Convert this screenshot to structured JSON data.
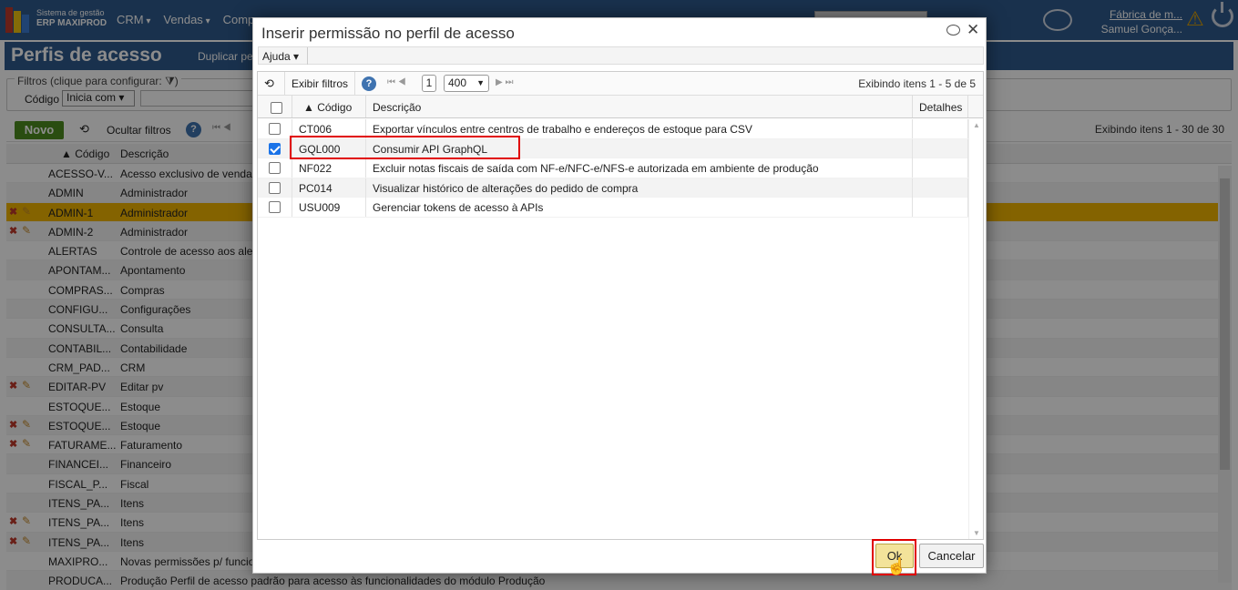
{
  "app": {
    "brand_line1": "Sistema de gestão",
    "brand_line2": "ERP MAXIPROD",
    "menu": [
      "CRM",
      "Vendas",
      "Compras"
    ],
    "user_company": "Fábrica de m...",
    "user_name": "Samuel Gonça..."
  },
  "page": {
    "title": "Perfis de acesso",
    "duplicate_label": "Duplicar pe",
    "filters_legend": "Filtros (clique para configurar: ⧩)",
    "filter_field_label": "Código",
    "filter_operator": "Inicia com",
    "new_button": "Novo",
    "hide_filters": "Ocultar filtros",
    "showing": "Exibindo itens 1 - 30 de 30",
    "col_code": "▲ Código",
    "col_desc": "Descrição",
    "rows": [
      {
        "code": "ACESSO-V...",
        "desc": "Acesso exclusivo de vendas",
        "edit": false,
        "selected": false
      },
      {
        "code": "ADMIN",
        "desc": "Administrador",
        "edit": false,
        "selected": false
      },
      {
        "code": "ADMIN-1",
        "desc": "Administrador",
        "edit": true,
        "selected": true
      },
      {
        "code": "ADMIN-2",
        "desc": "Administrador",
        "edit": true,
        "selected": false
      },
      {
        "code": "ALERTAS",
        "desc": "Controle de acesso aos ale",
        "edit": false,
        "selected": false
      },
      {
        "code": "APONTAM...",
        "desc": "Apontamento",
        "edit": false,
        "selected": false
      },
      {
        "code": "COMPRAS...",
        "desc": "Compras",
        "edit": false,
        "selected": false
      },
      {
        "code": "CONFIGU...",
        "desc": "Configurações",
        "edit": false,
        "selected": false
      },
      {
        "code": "CONSULTA...",
        "desc": "Consulta",
        "edit": false,
        "selected": false
      },
      {
        "code": "CONTABIL...",
        "desc": "Contabilidade",
        "edit": false,
        "selected": false
      },
      {
        "code": "CRM_PAD...",
        "desc": "CRM",
        "edit": false,
        "selected": false
      },
      {
        "code": "EDITAR-PV",
        "desc": "Editar pv",
        "edit": true,
        "selected": false
      },
      {
        "code": "ESTOQUE...",
        "desc": "Estoque",
        "edit": false,
        "selected": false
      },
      {
        "code": "ESTOQUE...",
        "desc": "Estoque",
        "edit": true,
        "selected": false
      },
      {
        "code": "FATURAME...",
        "desc": "Faturamento",
        "edit": true,
        "selected": false
      },
      {
        "code": "FINANCEI...",
        "desc": "Financeiro",
        "edit": false,
        "selected": false
      },
      {
        "code": "FISCAL_P...",
        "desc": "Fiscal",
        "edit": false,
        "selected": false
      },
      {
        "code": "ITENS_PA...",
        "desc": "Itens",
        "edit": false,
        "selected": false
      },
      {
        "code": "ITENS_PA...",
        "desc": "Itens",
        "edit": true,
        "selected": false
      },
      {
        "code": "ITENS_PA...",
        "desc": "Itens",
        "edit": true,
        "selected": false
      },
      {
        "code": "MAXIPRO...",
        "desc": "Novas permissões p/ funcio",
        "edit": false,
        "selected": false
      },
      {
        "code": "PRODUCA...",
        "desc": "Produção      Perfil de acesso padrão para acesso às funcionalidades do módulo Produção",
        "edit": false,
        "selected": false
      }
    ]
  },
  "modal": {
    "title": "Inserir permissão no perfil de acesso",
    "help_menu": "Ajuda",
    "show_filters": "Exibir filtros",
    "page_number": "1",
    "page_size": "400",
    "showing": "Exibindo itens 1 - 5 de 5",
    "col_code": "▲ Código",
    "col_desc": "Descrição",
    "col_details": "Detalhes",
    "rows": [
      {
        "code": "CT006",
        "desc": "Exportar vínculos entre centros de trabalho e endereços de estoque para CSV",
        "checked": false
      },
      {
        "code": "GQL000",
        "desc": "Consumir API GraphQL",
        "checked": true
      },
      {
        "code": "NF022",
        "desc": "Excluir notas fiscais de saída com NF-e/NFC-e/NFS-e autorizada em ambiente de produção",
        "checked": false
      },
      {
        "code": "PC014",
        "desc": "Visualizar histórico de alterações do pedido de compra",
        "checked": false
      },
      {
        "code": "USU009",
        "desc": "Gerenciar tokens de acesso à APIs",
        "checked": false
      }
    ],
    "ok_button": "Ok",
    "cancel_button": "Cancelar"
  }
}
